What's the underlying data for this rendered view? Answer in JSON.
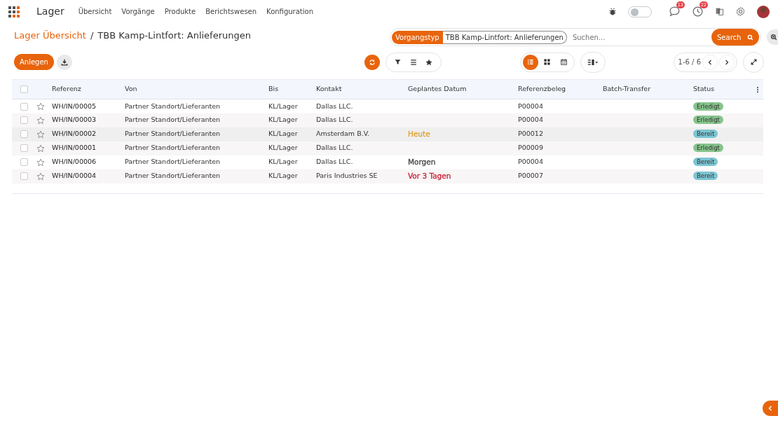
{
  "app": {
    "title": "Lager"
  },
  "menu": [
    "Übersicht",
    "Vorgänge",
    "Produkte",
    "Berichtswesen",
    "Konfiguration"
  ],
  "systray": {
    "debug_on": false,
    "messages_count": "13",
    "activities_count": "22"
  },
  "breadcrumb": {
    "parent": "Lager Übersicht",
    "separator": "/",
    "current": "TBB Kamp-Lintfort: Anlieferungen"
  },
  "search": {
    "facet_label": "Vorgangstyp",
    "facet_value": "TBB Kamp-Lintfort: Anlieferungen",
    "placeholder": "Suchen...",
    "button": "Search"
  },
  "buttons": {
    "create": "Anlegen"
  },
  "views": [
    {
      "kind": "list",
      "selected": true
    },
    {
      "kind": "kanban",
      "selected": false
    },
    {
      "kind": "calendar",
      "selected": false
    }
  ],
  "pager": "1-6 / 6",
  "table": {
    "select_all_checked": false,
    "columns": [
      "Referenz",
      "Von",
      "Bis",
      "Kontakt",
      "Geplantes Datum",
      "Referenzbeleg",
      "Batch-Transfer",
      "Status"
    ],
    "rows": [
      {
        "checked": false,
        "reference": "WH/IN/00005",
        "from": "Partner Standort/Lieferanten",
        "to": "KL/Lager",
        "contact": "Dallas LLC.",
        "source": "P00004",
        "status": {
          "text": "Erledigt",
          "kind": "done"
        }
      },
      {
        "checked": false,
        "reference": "WH/IN/00003",
        "from": "Partner Standort/Lieferanten",
        "to": "KL/Lager",
        "contact": "Dallas LLC.",
        "source": "P00004",
        "status": {
          "text": "Erledigt",
          "kind": "done"
        }
      },
      {
        "checked": false,
        "reference": "WH/IN/00002",
        "from": "Partner Standort/Lieferanten",
        "to": "KL/Lager",
        "contact": "Amsterdam B.V.",
        "planned_date": {
          "text": "Heute",
          "color": "#e0a030"
        },
        "source": "P00012",
        "status": {
          "text": "Bereit",
          "kind": "ready"
        }
      },
      {
        "checked": false,
        "reference": "WH/IN/00001",
        "from": "Partner Standort/Lieferanten",
        "to": "KL/Lager",
        "contact": "Dallas LLC.",
        "source": "P00009",
        "status": {
          "text": "Erledigt",
          "kind": "done"
        }
      },
      {
        "checked": false,
        "reference": "WH/IN/00006",
        "from": "Partner Standort/Lieferanten",
        "to": "KL/Lager",
        "contact": "Dallas LLC.",
        "planned_date": {
          "text": "Morgen",
          "color": "#4a4a4a"
        },
        "source": "P00004",
        "status": {
          "text": "Bereit",
          "kind": "ready"
        }
      },
      {
        "checked": false,
        "reference": "WH/IN/00004",
        "from": "Partner Standort/Lieferanten",
        "to": "KL/Lager",
        "contact": "Paris Industries SE",
        "planned_date": {
          "text": "Vor 3 Tagen",
          "color": "#c9283e"
        },
        "source": "P00007",
        "status": {
          "text": "Bereit",
          "kind": "ready"
        }
      }
    ]
  }
}
